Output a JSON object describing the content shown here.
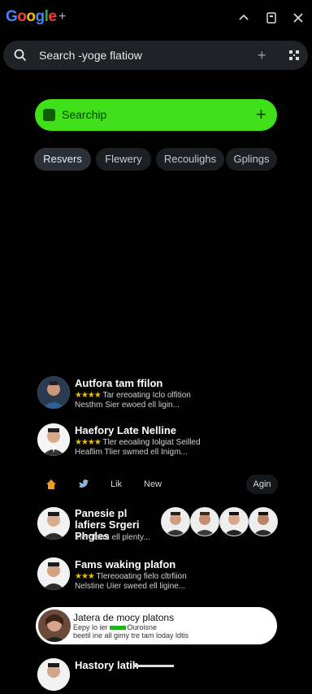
{
  "topbar": {
    "logo_letters": [
      "G",
      "o",
      "o",
      "g",
      "l",
      "e"
    ],
    "logo_colors": [
      "#4285F4",
      "#EA4335",
      "#FBBC05",
      "#4285F4",
      "#34A853",
      "#EA4335"
    ],
    "plus": "+"
  },
  "search": {
    "text": "Search -yoge flatiow"
  },
  "primary": {
    "label": "Searchip"
  },
  "chips": [
    "Resvers",
    "Flewery",
    "Recoulighs",
    "Gplings"
  ],
  "items": [
    {
      "title": "Autfora tam ffilon",
      "stars": "★★★★",
      "line2": "Tar ereoating Iclo olfition",
      "line3": "Nesthm Sier ewoed ell ligin..."
    },
    {
      "title": "Haefory Late Nelline",
      "stars": "★★★★",
      "line2": "Tler eeoaling Iolgiat Seilled",
      "line3": "Heaflim Tlier swmed ell Inigm..."
    },
    {
      "title": "Panesie pl lafiers Srgeri Phgles",
      "line2": "Ineroferm ell plenty..."
    },
    {
      "title": "Fams waking plafon",
      "stars": "★★★",
      "line2": "Tlereooating fielo cltrfiion",
      "line3": "Nelstine Uier sweed ell ligine..."
    }
  ],
  "tabs": {
    "like": "Lik",
    "new": "New",
    "again": "Agin"
  },
  "highlight": {
    "title": "Jatera de mocy platons",
    "line2a": "Eepy lo ier",
    "line2b": "Ouroisne",
    "line3": "beetil ine all gimy tre tam loday ldtis"
  },
  "last_item": {
    "title": "Hastory latih"
  }
}
